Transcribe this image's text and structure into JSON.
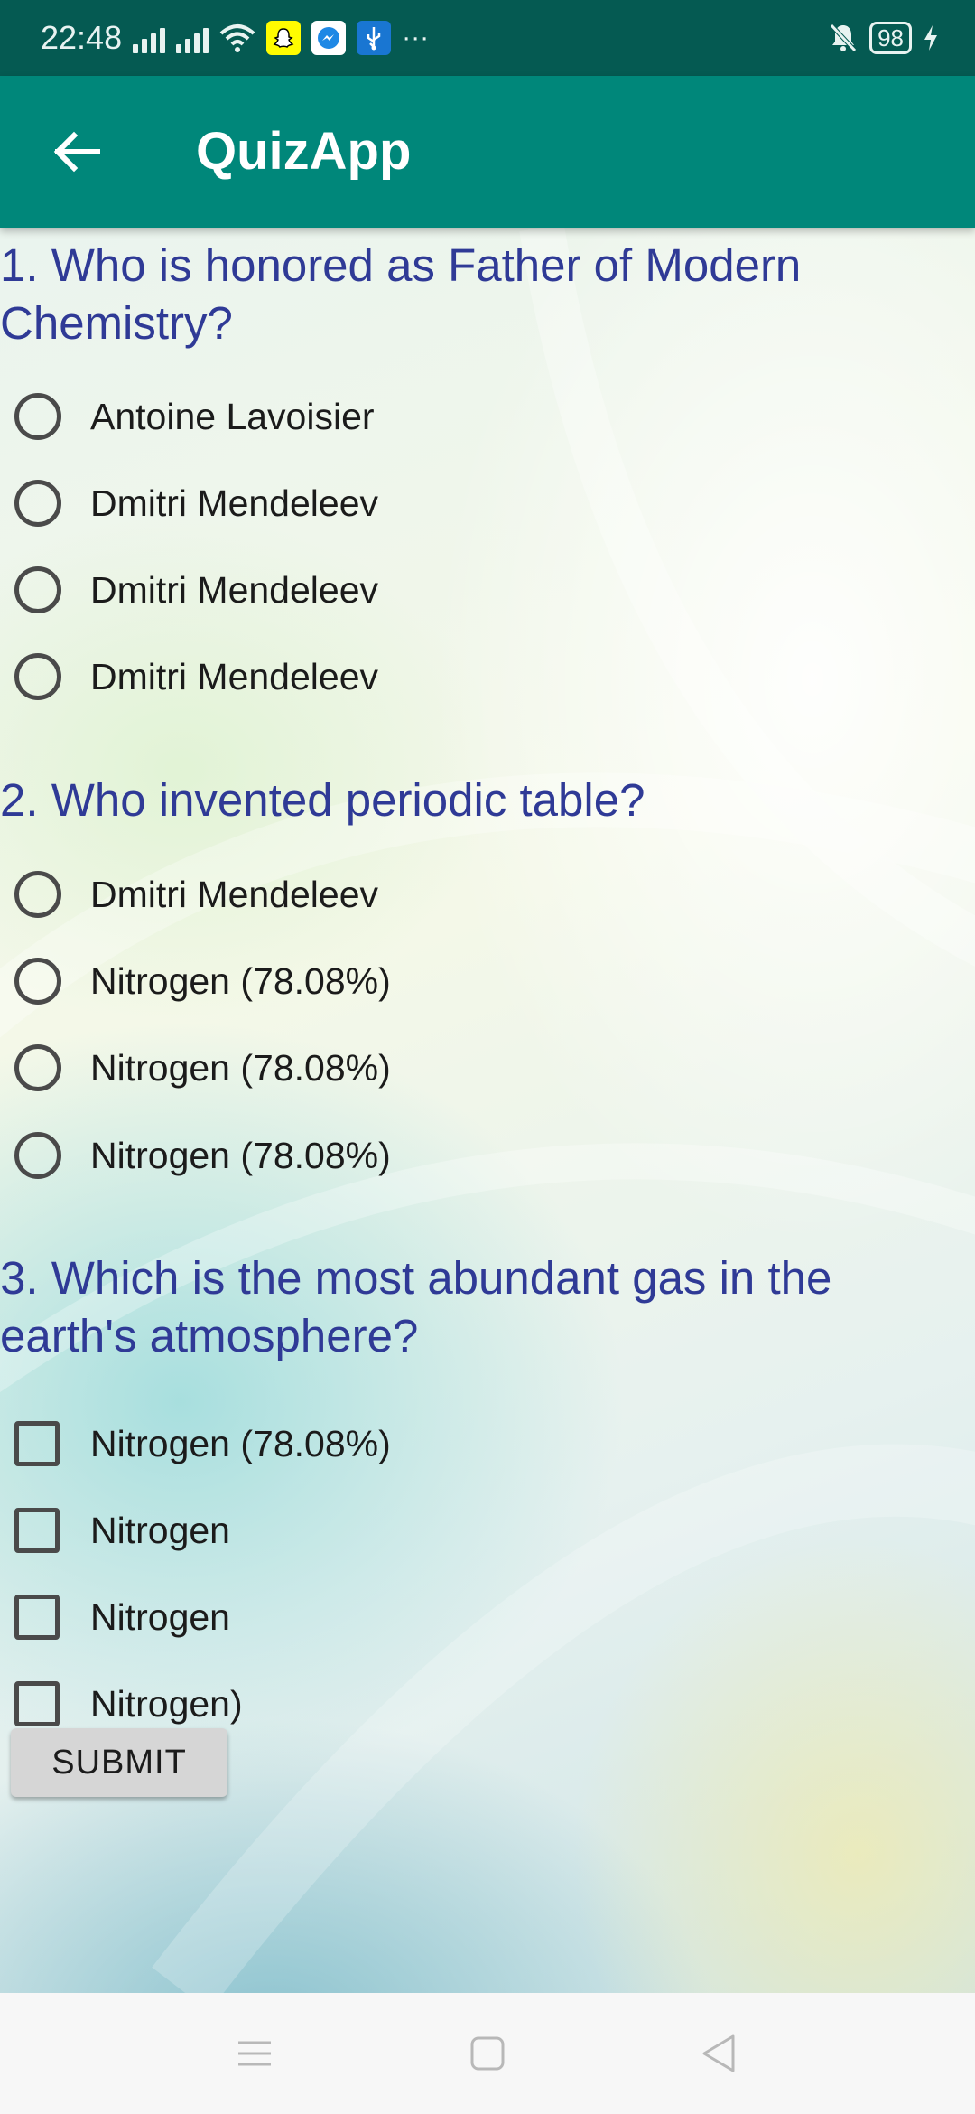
{
  "status_bar": {
    "time": "22:48",
    "battery": "98",
    "more_indicator": "···",
    "icons": [
      "signal-icon",
      "signal-icon",
      "wifi-icon",
      "snapchat-icon",
      "messenger-icon",
      "usb-icon",
      "notifications-off-icon",
      "battery-icon",
      "charging-icon"
    ]
  },
  "app_bar": {
    "title": "QuizApp",
    "back_icon": "arrow-back-icon"
  },
  "questions": [
    {
      "text": "1. Who is honored as Father of Modern Chemistry?",
      "type": "radio",
      "options": [
        "Antoine Lavoisier",
        "Dmitri Mendeleev",
        "Dmitri Mendeleev",
        "Dmitri Mendeleev"
      ]
    },
    {
      "text": "2. Who invented periodic table?",
      "type": "radio",
      "options": [
        "Dmitri Mendeleev",
        "Nitrogen (78.08%)",
        "Nitrogen (78.08%)",
        "Nitrogen (78.08%)"
      ]
    },
    {
      "text": "3. Which is the most abundant gas in the earth's atmosphere?",
      "type": "checkbox",
      "options": [
        "Nitrogen (78.08%)",
        "Nitrogen",
        "Nitrogen",
        "Nitrogen)"
      ]
    }
  ],
  "submit_label": "SUBMIT",
  "nav_bar": {
    "icons": [
      "menu-icon",
      "home-icon",
      "back-triangle-icon"
    ]
  },
  "colors": {
    "status_bar": "#055a52",
    "app_bar": "#00877a",
    "question_text": "#2f3a96"
  }
}
